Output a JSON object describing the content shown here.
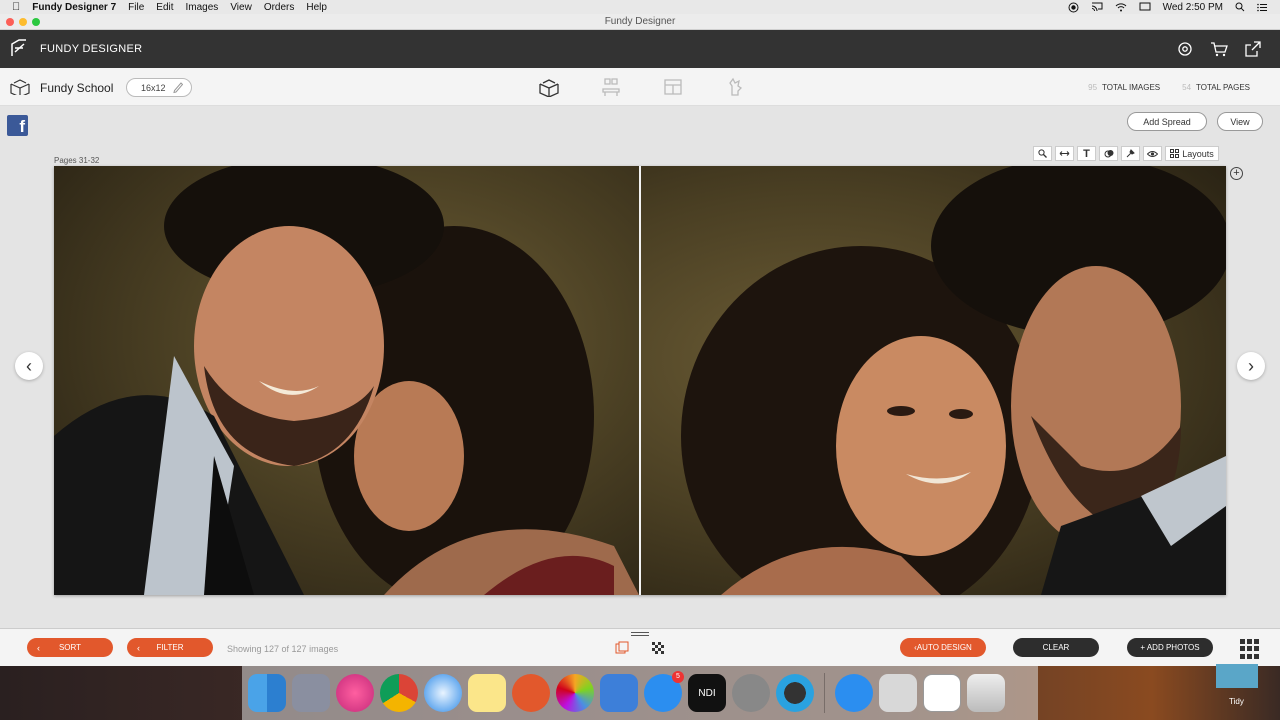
{
  "menubar": {
    "app_name": "Fundy Designer 7",
    "items": [
      "File",
      "Edit",
      "Images",
      "View",
      "Orders",
      "Help"
    ],
    "clock": "Wed 2:50 PM"
  },
  "window": {
    "title": "Fundy Designer"
  },
  "header": {
    "brand": "FUNDY DESIGNER"
  },
  "toolbar": {
    "album_name": "Fundy School",
    "album_size": "16x12",
    "total_images_count": "95",
    "total_images_label": "TOTAL IMAGES",
    "total_pages_count": "54",
    "total_pages_label": "TOTAL PAGES"
  },
  "canvas": {
    "facebook_label": "f",
    "add_spread_label": "Add Spread",
    "view_label": "View",
    "pages_label": "Pages 31-32",
    "tools": {
      "text_tool": "T",
      "layouts_label": "Layouts"
    },
    "prev_arrow": "‹",
    "next_arrow": "›",
    "add_page_symbol": "+"
  },
  "bottom": {
    "sort_label": "SORT",
    "filter_label": "FILTER",
    "showing_text": "Showing 127 of 127 images",
    "auto_design_label": "AUTO DESIGN",
    "clear_label": "CLEAR",
    "add_photos_label": "+ ADD PHOTOS"
  },
  "dock": {
    "app_store_badge": "5",
    "ndi_label": "NDI",
    "tidy_label": "Tidy"
  },
  "colors": {
    "accent_orange": "#e2582c",
    "header_dark": "#333333",
    "facebook_blue": "#3b5998"
  }
}
